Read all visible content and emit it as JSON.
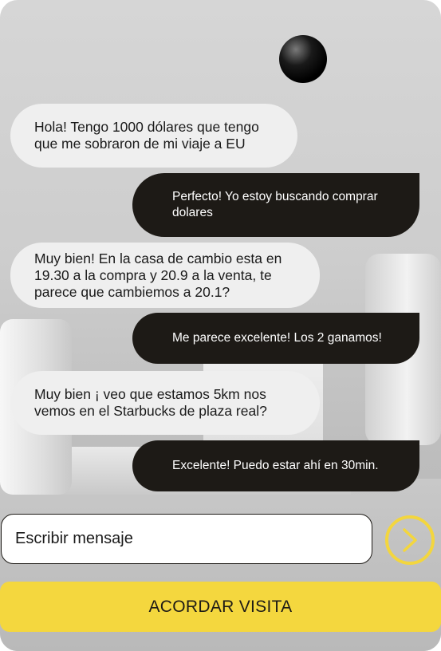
{
  "chat": {
    "messages": [
      {
        "sender": "other",
        "text": "Hola! Tengo 1000 dólares que tengo que me sobraron de mi viaje a EU"
      },
      {
        "sender": "me",
        "text": "Perfecto! Yo estoy buscando comprar dolares"
      },
      {
        "sender": "other",
        "text": "Muy bien! En la casa de cambio esta en 19.30 a la compra y 20.9 a la venta, te parece que cambiemos a 20.1?"
      },
      {
        "sender": "me",
        "text": "Me parece excelente! Los 2 ganamos!"
      },
      {
        "sender": "other",
        "text": "Muy bien ¡ veo que estamos 5km nos vemos en el Starbucks de plaza real?"
      },
      {
        "sender": "me",
        "text": "Excelente! Puedo estar ahí en 30min."
      }
    ]
  },
  "composer": {
    "placeholder": "Escribir mensaje",
    "send_icon": "chevron-right-icon"
  },
  "cta": {
    "label": "ACORDAR VISITA"
  },
  "colors": {
    "accent": "#f4d73e",
    "outgoing_bubble": "#1d1a16",
    "incoming_bubble": "#efefef"
  }
}
